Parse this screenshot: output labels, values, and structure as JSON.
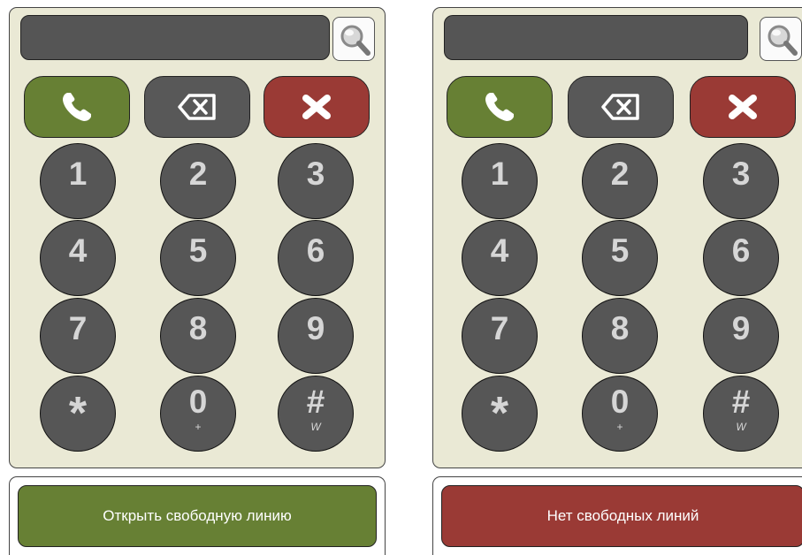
{
  "left_dialer": {
    "search": {
      "value": "",
      "placeholder": ""
    },
    "actions": {
      "call_icon": "phone-icon",
      "backspace_icon": "backspace-icon",
      "clear_icon": "close-x-icon"
    },
    "keys": [
      {
        "digit": "1",
        "sub": ""
      },
      {
        "digit": "2",
        "sub": ""
      },
      {
        "digit": "3",
        "sub": ""
      },
      {
        "digit": "4",
        "sub": ""
      },
      {
        "digit": "5",
        "sub": ""
      },
      {
        "digit": "6",
        "sub": ""
      },
      {
        "digit": "7",
        "sub": ""
      },
      {
        "digit": "8",
        "sub": ""
      },
      {
        "digit": "9",
        "sub": ""
      },
      {
        "digit": "*",
        "sub": ""
      },
      {
        "digit": "0",
        "sub": "+"
      },
      {
        "digit": "#",
        "sub": "W"
      }
    ],
    "status_label": "Открыть свободную линию"
  },
  "right_dialer": {
    "search": {
      "value": "",
      "placeholder": ""
    },
    "actions": {
      "call_icon": "phone-icon",
      "backspace_icon": "backspace-icon",
      "clear_icon": "close-x-icon"
    },
    "keys": [
      {
        "digit": "1",
        "sub": ""
      },
      {
        "digit": "2",
        "sub": ""
      },
      {
        "digit": "3",
        "sub": ""
      },
      {
        "digit": "4",
        "sub": ""
      },
      {
        "digit": "5",
        "sub": ""
      },
      {
        "digit": "6",
        "sub": ""
      },
      {
        "digit": "7",
        "sub": ""
      },
      {
        "digit": "8",
        "sub": ""
      },
      {
        "digit": "9",
        "sub": ""
      },
      {
        "digit": "*",
        "sub": ""
      },
      {
        "digit": "0",
        "sub": "+"
      },
      {
        "digit": "#",
        "sub": "W"
      }
    ],
    "status_label": "Нет свободных линий"
  },
  "colors": {
    "panel_bg": "#eae9d5",
    "key_bg": "#565656",
    "call_green": "#678034",
    "clear_red": "#9a3a35",
    "backspace_gray": "#585858"
  }
}
